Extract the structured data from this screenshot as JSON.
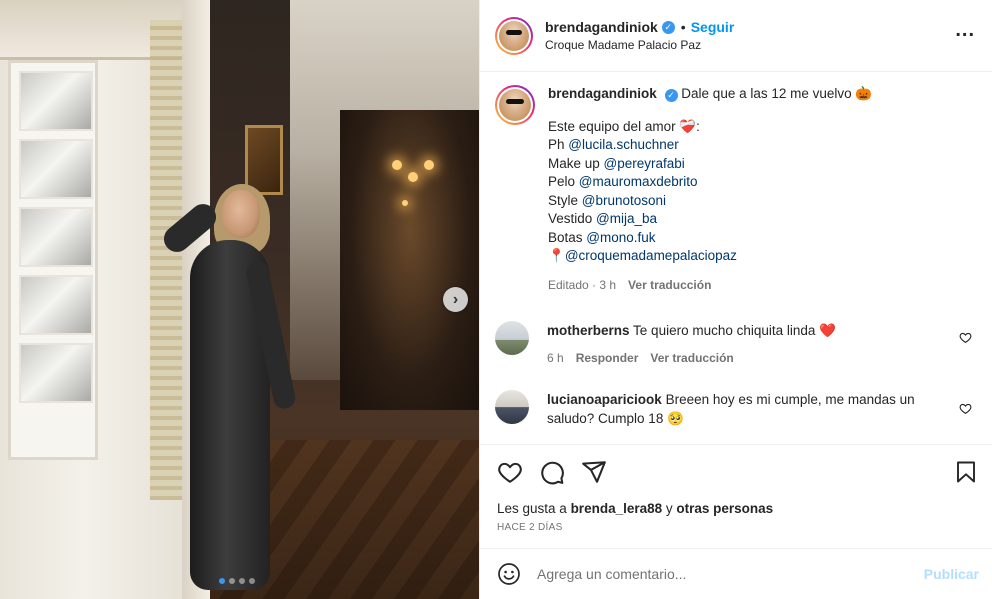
{
  "post": {
    "nav_next_glyph": "›",
    "carousel_dots": 4,
    "carousel_active": 0
  },
  "header": {
    "username": "brendagandiniok",
    "verified_glyph": "✓",
    "separator": "•",
    "follow_label": "Seguir",
    "location": "Croque Madame Palacio Paz",
    "more_glyph": "..."
  },
  "caption": {
    "username": "brendagandiniok",
    "first_line": "Dale que a las 12 me vuelvo 🎃",
    "lines": [
      {
        "prefix": "Este equipo del amor ❤️‍🩹:",
        "mention": ""
      },
      {
        "prefix": "Ph ",
        "mention": "@lucila.schuchner"
      },
      {
        "prefix": "Make up ",
        "mention": "@pereyrafabi"
      },
      {
        "prefix": "Pelo ",
        "mention": "@mauromaxdebrito"
      },
      {
        "prefix": "Style ",
        "mention": "@brunotosoni"
      },
      {
        "prefix": "Vestido ",
        "mention": "@mija_ba"
      },
      {
        "prefix": "Botas ",
        "mention": "@mono.fuk"
      },
      {
        "prefix": "📍",
        "mention": "@croquemadamepalaciopaz"
      }
    ],
    "edited": "Editado · 3 h",
    "translate": "Ver traducción"
  },
  "comments": [
    {
      "username": "motherberns",
      "text": "Te quiero mucho chiquita linda ❤️",
      "time": "6 h",
      "reply": "Responder",
      "translate": "Ver traducción"
    },
    {
      "username": "lucianoapariciook",
      "text": "Breeen hoy es mi cumple, me mandas un saludo? Cumplo 18 🥺"
    }
  ],
  "actions": {
    "likes_prefix": "Les gusta a ",
    "likes_user": "brenda_lera88",
    "likes_suffix": " y ",
    "likes_others": "otras personas",
    "ago": "HACE 2 DÍAS"
  },
  "add_comment": {
    "placeholder": "Agrega un comentario...",
    "publish_label": "Publicar"
  },
  "colors": {
    "accent": "#0095f6",
    "mention": "#00376b",
    "muted": "#737373",
    "publish_disabled": "#b2dffc"
  }
}
